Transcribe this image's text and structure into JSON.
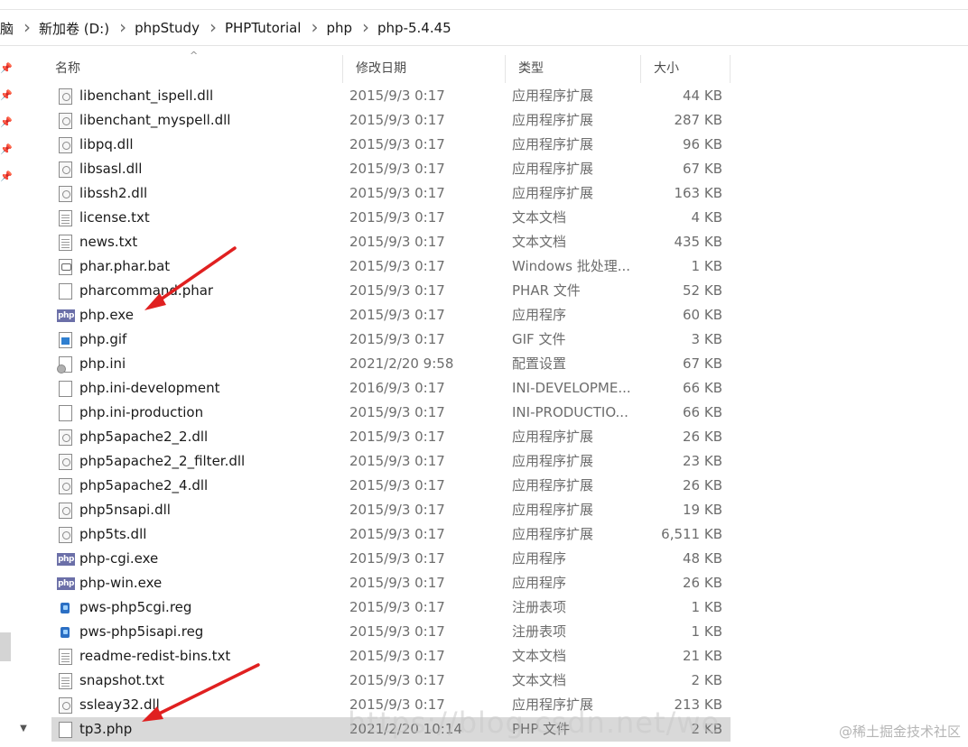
{
  "breadcrumb": [
    "脑",
    "新加卷 (D:)",
    "phpStudy",
    "PHPTutorial",
    "php",
    "php-5.4.45"
  ],
  "columns": {
    "name": "名称",
    "date": "修改日期",
    "type": "类型",
    "size": "大小"
  },
  "files": [
    {
      "name": "libenchant_ispell.dll",
      "date": "2015/9/3 0:17",
      "type": "应用程序扩展",
      "size": "44 KB",
      "icon": "dll-file-icon"
    },
    {
      "name": "libenchant_myspell.dll",
      "date": "2015/9/3 0:17",
      "type": "应用程序扩展",
      "size": "287 KB",
      "icon": "dll-file-icon"
    },
    {
      "name": "libpq.dll",
      "date": "2015/9/3 0:17",
      "type": "应用程序扩展",
      "size": "96 KB",
      "icon": "dll-file-icon"
    },
    {
      "name": "libsasl.dll",
      "date": "2015/9/3 0:17",
      "type": "应用程序扩展",
      "size": "67 KB",
      "icon": "dll-file-icon"
    },
    {
      "name": "libssh2.dll",
      "date": "2015/9/3 0:17",
      "type": "应用程序扩展",
      "size": "163 KB",
      "icon": "dll-file-icon"
    },
    {
      "name": "license.txt",
      "date": "2015/9/3 0:17",
      "type": "文本文档",
      "size": "4 KB",
      "icon": "text-file-icon"
    },
    {
      "name": "news.txt",
      "date": "2015/9/3 0:17",
      "type": "文本文档",
      "size": "435 KB",
      "icon": "text-file-icon"
    },
    {
      "name": "phar.phar.bat",
      "date": "2015/9/3 0:17",
      "type": "Windows 批处理...",
      "size": "1 KB",
      "icon": "batch-file-icon"
    },
    {
      "name": "pharcommand.phar",
      "date": "2015/9/3 0:17",
      "type": "PHAR 文件",
      "size": "52 KB",
      "icon": "blank-file-icon"
    },
    {
      "name": "php.exe",
      "date": "2015/9/3 0:17",
      "type": "应用程序",
      "size": "60 KB",
      "icon": "php-exe-icon"
    },
    {
      "name": "php.gif",
      "date": "2015/9/3 0:17",
      "type": "GIF 文件",
      "size": "3 KB",
      "icon": "image-file-icon"
    },
    {
      "name": "php.ini",
      "date": "2021/2/20 9:58",
      "type": "配置设置",
      "size": "67 KB",
      "icon": "ini-file-icon"
    },
    {
      "name": "php.ini-development",
      "date": "2016/9/3 0:17",
      "type": "INI-DEVELOPME...",
      "size": "66 KB",
      "icon": "blank-file-icon"
    },
    {
      "name": "php.ini-production",
      "date": "2015/9/3 0:17",
      "type": "INI-PRODUCTIO...",
      "size": "66 KB",
      "icon": "blank-file-icon"
    },
    {
      "name": "php5apache2_2.dll",
      "date": "2015/9/3 0:17",
      "type": "应用程序扩展",
      "size": "26 KB",
      "icon": "dll-file-icon"
    },
    {
      "name": "php5apache2_2_filter.dll",
      "date": "2015/9/3 0:17",
      "type": "应用程序扩展",
      "size": "23 KB",
      "icon": "dll-file-icon"
    },
    {
      "name": "php5apache2_4.dll",
      "date": "2015/9/3 0:17",
      "type": "应用程序扩展",
      "size": "26 KB",
      "icon": "dll-file-icon"
    },
    {
      "name": "php5nsapi.dll",
      "date": "2015/9/3 0:17",
      "type": "应用程序扩展",
      "size": "19 KB",
      "icon": "dll-file-icon"
    },
    {
      "name": "php5ts.dll",
      "date": "2015/9/3 0:17",
      "type": "应用程序扩展",
      "size": "6,511 KB",
      "icon": "dll-file-icon"
    },
    {
      "name": "php-cgi.exe",
      "date": "2015/9/3 0:17",
      "type": "应用程序",
      "size": "48 KB",
      "icon": "php-exe-icon"
    },
    {
      "name": "php-win.exe",
      "date": "2015/9/3 0:17",
      "type": "应用程序",
      "size": "26 KB",
      "icon": "php-exe-icon"
    },
    {
      "name": "pws-php5cgi.reg",
      "date": "2015/9/3 0:17",
      "type": "注册表项",
      "size": "1 KB",
      "icon": "registry-file-icon"
    },
    {
      "name": "pws-php5isapi.reg",
      "date": "2015/9/3 0:17",
      "type": "注册表项",
      "size": "1 KB",
      "icon": "registry-file-icon"
    },
    {
      "name": "readme-redist-bins.txt",
      "date": "2015/9/3 0:17",
      "type": "文本文档",
      "size": "21 KB",
      "icon": "text-file-icon"
    },
    {
      "name": "snapshot.txt",
      "date": "2015/9/3 0:17",
      "type": "文本文档",
      "size": "2 KB",
      "icon": "text-file-icon"
    },
    {
      "name": "ssleay32.dll",
      "date": "2015/9/3 0:17",
      "type": "应用程序扩展",
      "size": "213 KB",
      "icon": "dll-file-icon"
    },
    {
      "name": "tp3.php",
      "date": "2021/2/20 10:14",
      "type": "PHP 文件",
      "size": "2 KB",
      "icon": "blank-file-icon",
      "selected": true
    }
  ],
  "exe_icon_text": "php",
  "watermark": "https://blog.csdn.net/we",
  "credit": "@稀土掘金技术社区",
  "colors": {
    "annotation_red": "#e02020",
    "selection": "#d9d9d9",
    "exe_icon_bg": "#6b6fa8"
  }
}
